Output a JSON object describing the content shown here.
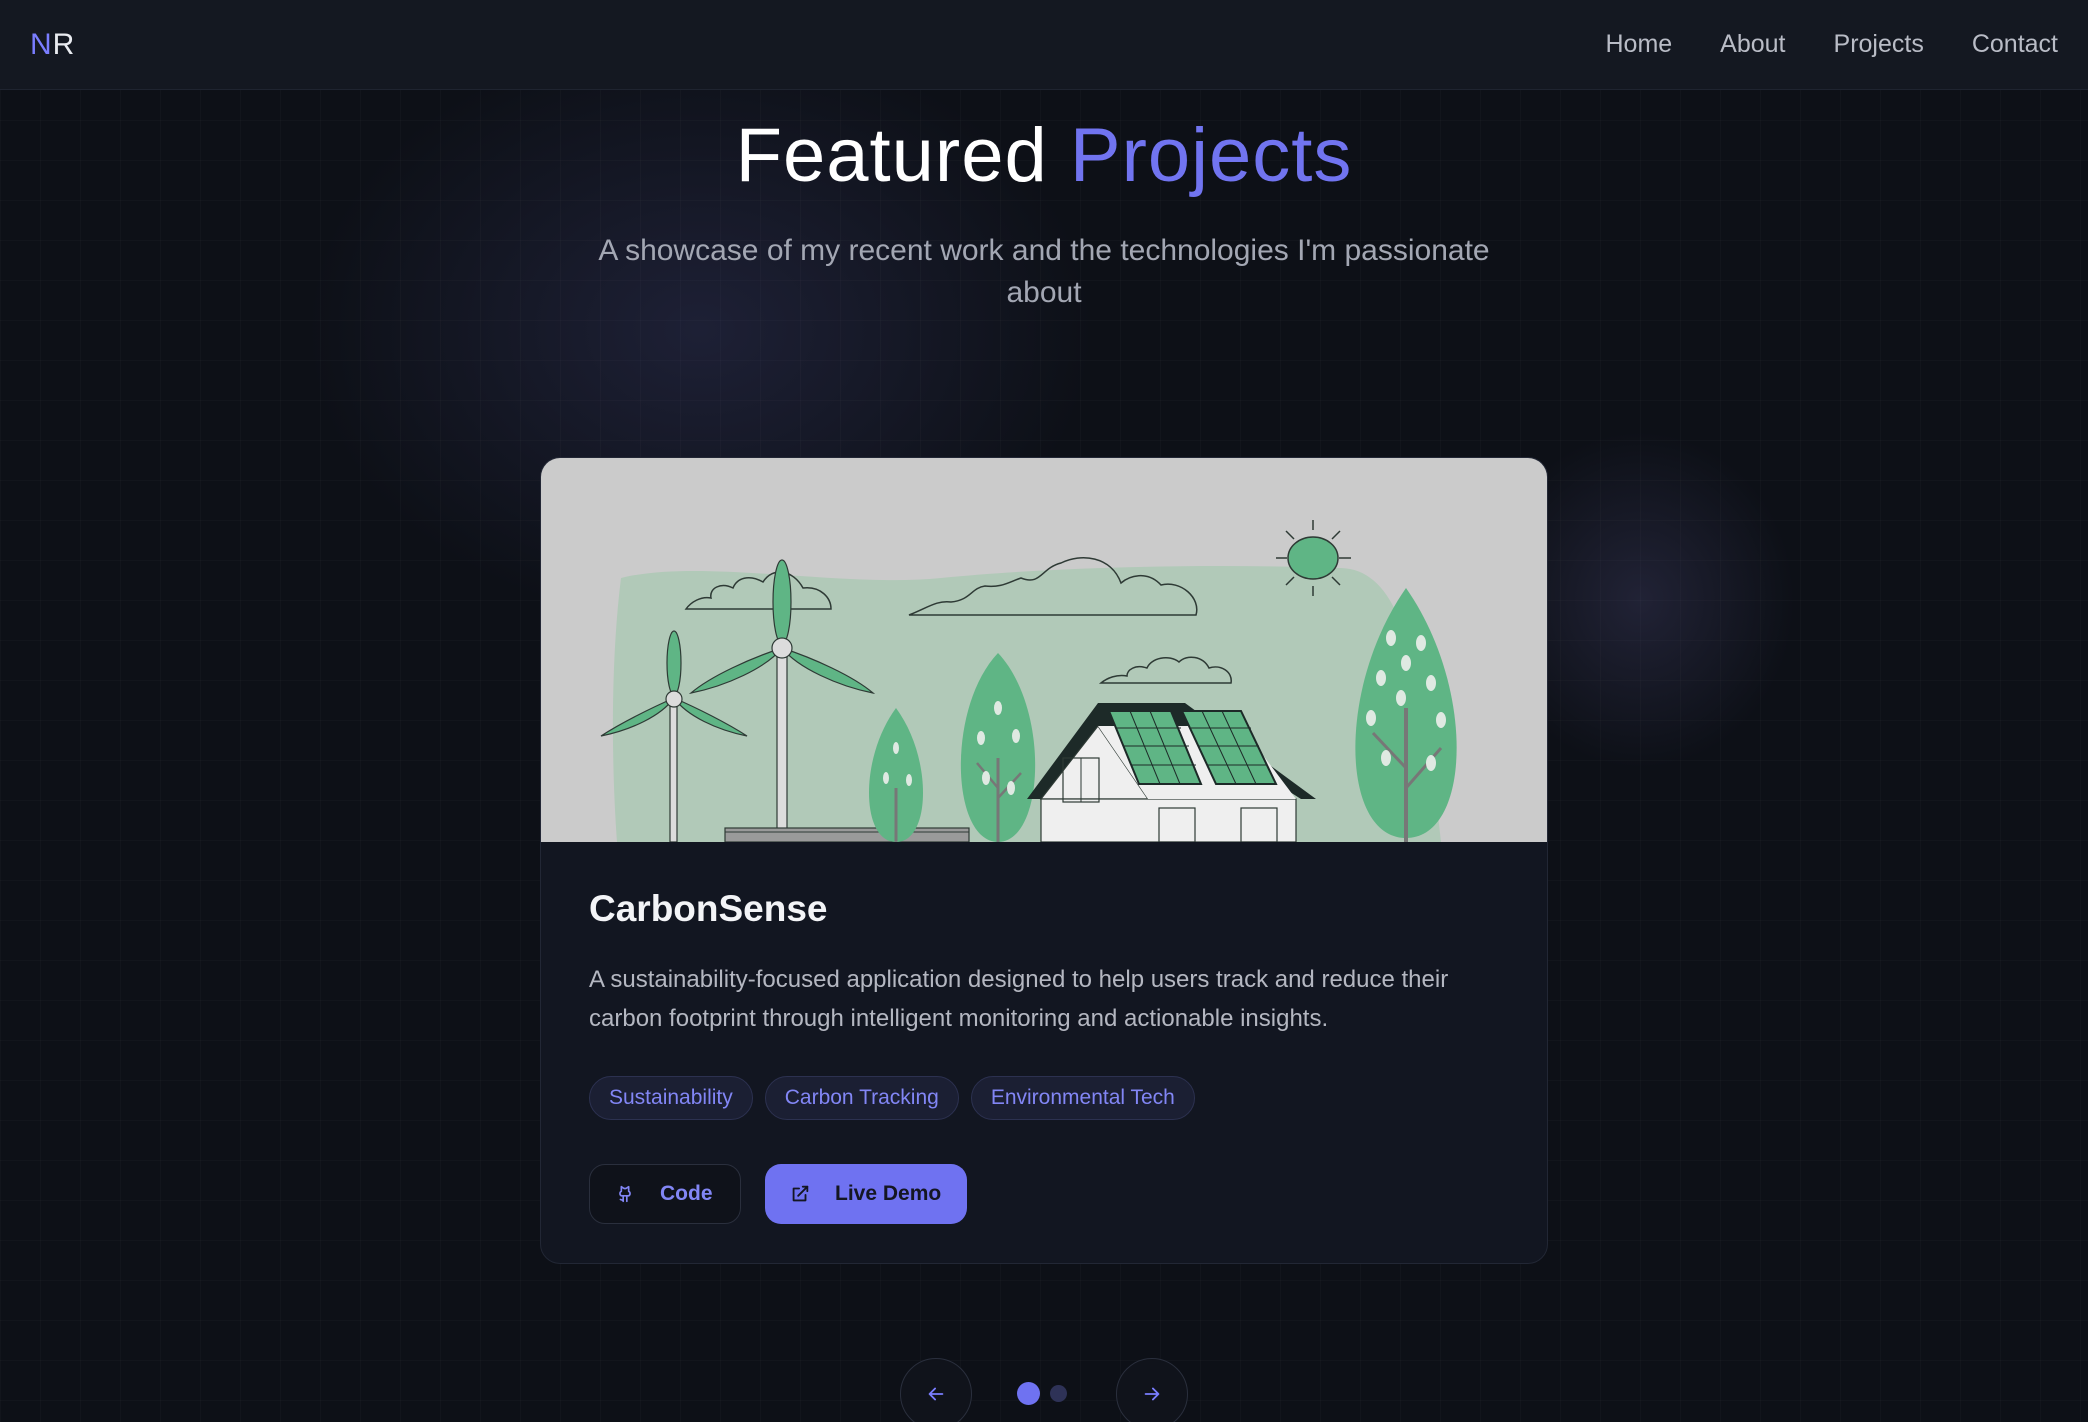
{
  "nav": {
    "logo_first": "N",
    "logo_second": "R",
    "links": [
      "Home",
      "About",
      "Projects",
      "Contact"
    ]
  },
  "header": {
    "title_part1": "Featured",
    "title_part2": "Projects",
    "subtitle": "A showcase of my recent work and the technologies I'm passionate about"
  },
  "project": {
    "title": "CarbonSense",
    "description": "A sustainability-focused application designed to help users track and reduce their carbon footprint through intelligent monitoring and actionable insights.",
    "tags": [
      "Sustainability",
      "Carbon Tracking",
      "Environmental Tech"
    ],
    "code_label": "Code",
    "demo_label": "Live Demo",
    "image_icon": "wind-turbines-solar-house-illustration"
  },
  "carousel": {
    "prev_icon": "arrow-left-icon",
    "next_icon": "arrow-right-icon",
    "slide_count": 2,
    "active_index": 0
  },
  "colors": {
    "accent": "#6f72f1",
    "background": "#0d1017",
    "card": "#121621",
    "illustration_green": "#5fb585"
  }
}
